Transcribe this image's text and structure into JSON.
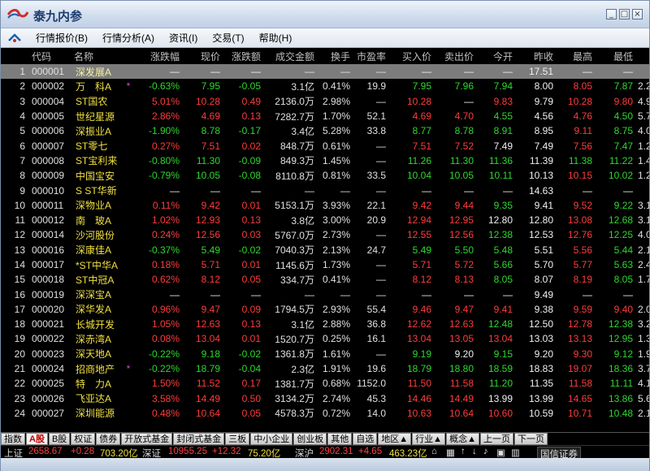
{
  "window": {
    "title": "泰九内参",
    "controls": [
      "_",
      "□",
      "×"
    ]
  },
  "menu": [
    "行情报价(B)",
    "行情分析(A)",
    "资讯(I)",
    "交易(T)",
    "帮助(H)"
  ],
  "columns": [
    "",
    "代码",
    "名称",
    "",
    "涨跌幅",
    "现价",
    "涨跌额",
    "成交金额",
    "换手",
    "市盈率",
    "买入价",
    "卖出价",
    "今开",
    "昨收",
    "最高",
    "最低",
    ""
  ],
  "rows": [
    [
      "1",
      "000001",
      "深发展A",
      "",
      "—",
      "—",
      "—",
      "—",
      "—",
      "—",
      "—",
      "—",
      "—",
      "17.51",
      "—",
      "—",
      ""
    ],
    [
      "2",
      "000002",
      "万　科A",
      "*",
      "-0.63%",
      "7.95",
      "-0.05",
      "3.1亿",
      "0.41%",
      "19.9",
      "7.95",
      "7.96",
      "7.94",
      "8.00",
      "8.05",
      "7.87",
      "2.25%"
    ],
    [
      "3",
      "000004",
      "ST国农",
      "",
      "5.01%",
      "10.28",
      "0.49",
      "2136.0万",
      "2.98%",
      "—",
      "10.28",
      "—",
      "9.83",
      "9.79",
      "10.28",
      "9.80",
      "4.90%"
    ],
    [
      "4",
      "000005",
      "世纪星源",
      "",
      "2.86%",
      "4.69",
      "0.13",
      "7282.7万",
      "1.70%",
      "52.1",
      "4.69",
      "4.70",
      "4.55",
      "4.56",
      "4.76",
      "4.50",
      "5.70%"
    ],
    [
      "5",
      "000006",
      "深振业A",
      "",
      "-1.90%",
      "8.78",
      "-0.17",
      "3.4亿",
      "5.28%",
      "33.8",
      "8.77",
      "8.78",
      "8.91",
      "8.95",
      "9.11",
      "8.75",
      "4.02%"
    ],
    [
      "6",
      "000007",
      "ST零七",
      "",
      "0.27%",
      "7.51",
      "0.02",
      "848.7万",
      "0.61%",
      "—",
      "7.51",
      "7.52",
      "7.49",
      "7.49",
      "7.56",
      "7.47",
      "1.20%"
    ],
    [
      "7",
      "000008",
      "ST宝利来",
      "",
      "-0.80%",
      "11.30",
      "-0.09",
      "849.3万",
      "1.45%",
      "—",
      "11.26",
      "11.30",
      "11.36",
      "11.39",
      "11.38",
      "11.22",
      "1.40%"
    ],
    [
      "8",
      "000009",
      "中国宝安",
      "",
      "-0.79%",
      "10.05",
      "-0.08",
      "8110.8万",
      "0.81%",
      "33.5",
      "10.04",
      "10.05",
      "10.11",
      "10.13",
      "10.15",
      "10.02",
      "1.28%"
    ],
    [
      "9",
      "000010",
      "S ST华新",
      "",
      "—",
      "—",
      "—",
      "—",
      "—",
      "—",
      "—",
      "—",
      "—",
      "14.63",
      "—",
      "—",
      ""
    ],
    [
      "10",
      "000011",
      "深物业A",
      "",
      "0.11%",
      "9.42",
      "0.01",
      "5153.1万",
      "3.93%",
      "22.1",
      "9.42",
      "9.44",
      "9.35",
      "9.41",
      "9.52",
      "9.22",
      "3.19%"
    ],
    [
      "11",
      "000012",
      "南　玻A",
      "",
      "1.02%",
      "12.93",
      "0.13",
      "3.8亿",
      "3.00%",
      "20.9",
      "12.94",
      "12.95",
      "12.80",
      "12.80",
      "13.08",
      "12.68",
      "3.13%"
    ],
    [
      "12",
      "000014",
      "沙河股份",
      "",
      "0.24%",
      "12.56",
      "0.03",
      "5767.0万",
      "2.73%",
      "—",
      "12.55",
      "12.56",
      "12.38",
      "12.53",
      "12.76",
      "12.25",
      "4.07%"
    ],
    [
      "13",
      "000016",
      "深康佳A",
      "",
      "-0.37%",
      "5.49",
      "-0.02",
      "7040.3万",
      "2.13%",
      "24.7",
      "5.49",
      "5.50",
      "5.48",
      "5.51",
      "5.56",
      "5.44",
      "2.18%"
    ],
    [
      "14",
      "000017",
      "*ST中华A",
      "",
      "0.18%",
      "5.71",
      "0.01",
      "1145.6万",
      "1.73%",
      "—",
      "5.71",
      "5.72",
      "5.66",
      "5.70",
      "5.77",
      "5.63",
      "2.46%"
    ],
    [
      "15",
      "000018",
      "ST中冠A",
      "",
      "0.62%",
      "8.12",
      "0.05",
      "334.7万",
      "0.41%",
      "—",
      "8.12",
      "8.13",
      "8.05",
      "8.07",
      "8.19",
      "8.05",
      "1.73%"
    ],
    [
      "16",
      "000019",
      "深深宝A",
      "",
      "—",
      "—",
      "—",
      "—",
      "—",
      "—",
      "—",
      "—",
      "—",
      "9.49",
      "—",
      "—",
      ""
    ],
    [
      "17",
      "000020",
      "深华发A",
      "",
      "0.96%",
      "9.47",
      "0.09",
      "1794.5万",
      "2.93%",
      "55.4",
      "9.46",
      "9.47",
      "9.41",
      "9.38",
      "9.59",
      "9.40",
      "2.03%"
    ],
    [
      "18",
      "000021",
      "长城开发",
      "",
      "1.05%",
      "12.63",
      "0.13",
      "3.1亿",
      "2.88%",
      "36.8",
      "12.62",
      "12.63",
      "12.48",
      "12.50",
      "12.78",
      "12.38",
      "3.20%"
    ],
    [
      "19",
      "000022",
      "深赤湾A",
      "",
      "0.08%",
      "13.04",
      "0.01",
      "1520.7万",
      "0.25%",
      "16.1",
      "13.04",
      "13.05",
      "13.04",
      "13.03",
      "13.13",
      "12.95",
      "1.38%"
    ],
    [
      "20",
      "000023",
      "深天地A",
      "",
      "-0.22%",
      "9.18",
      "-0.02",
      "1361.8万",
      "1.61%",
      "—",
      "9.19",
      "9.20",
      "9.15",
      "9.20",
      "9.30",
      "9.12",
      "1.96%"
    ],
    [
      "21",
      "000024",
      "招商地产",
      "*",
      "-0.22%",
      "18.79",
      "-0.04",
      "2.3亿",
      "1.91%",
      "19.6",
      "18.79",
      "18.80",
      "18.59",
      "18.83",
      "19.07",
      "18.36",
      "3.77%"
    ],
    [
      "22",
      "000025",
      "特　力A",
      "",
      "1.50%",
      "11.52",
      "0.17",
      "1381.7万",
      "0.68%",
      "1152.0",
      "11.50",
      "11.58",
      "11.20",
      "11.35",
      "11.58",
      "11.11",
      "4.14%"
    ],
    [
      "23",
      "000026",
      "飞亚达A",
      "",
      "3.58%",
      "14.49",
      "0.50",
      "3134.2万",
      "2.74%",
      "45.3",
      "14.46",
      "14.49",
      "13.99",
      "13.99",
      "14.65",
      "13.86",
      "5.65%"
    ],
    [
      "24",
      "000027",
      "深圳能源",
      "",
      "0.48%",
      "10.64",
      "0.05",
      "4578.3万",
      "0.72%",
      "14.0",
      "10.63",
      "10.64",
      "10.60",
      "10.59",
      "10.71",
      "10.48",
      "2.12%"
    ]
  ],
  "tabs": [
    "指数",
    "A股",
    "B股",
    "权证",
    "债券",
    "开放式基金",
    "封闭式基金",
    "三板",
    "中小企业",
    "创业板",
    "其他",
    "自选",
    "地区▲",
    "行业▲",
    "概念▲",
    "上一页",
    "下一页"
  ],
  "active_tab": "A股",
  "status": {
    "sh_label": "上证",
    "sh_index": "2658.67",
    "sh_change": "+0.28",
    "sh_vol": "703.20亿",
    "sz_label": "深证",
    "sz_index": "10955.25",
    "sz_change": "+12.32",
    "sz_vol": "75.20亿",
    "hs_label": "深沪",
    "hs_index": "2902.31",
    "hs_change": "+4.65",
    "hs_vol": "463.23亿",
    "brand": "国信证券"
  },
  "colors": {
    "up": "#ff3c3c",
    "down": "#2ed82e",
    "name": "#f0e040",
    "background": "#000000",
    "selected_row": "#7c7c7c"
  }
}
